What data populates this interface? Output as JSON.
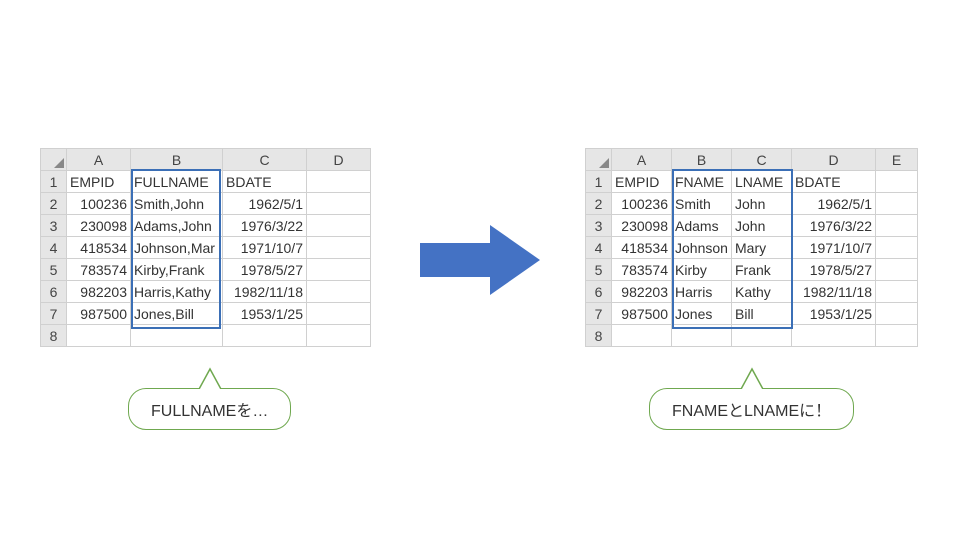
{
  "left": {
    "cols": [
      "A",
      "B",
      "C",
      "D"
    ],
    "rows": [
      "1",
      "2",
      "3",
      "4",
      "5",
      "6",
      "7",
      "8"
    ],
    "header": {
      "A": "EMPID",
      "B": "FULLNAME",
      "C": "BDATE"
    },
    "data": [
      {
        "A": "100236",
        "B": "Smith,John",
        "C": "1962/5/1"
      },
      {
        "A": "230098",
        "B": "Adams,John",
        "C": "1976/3/22"
      },
      {
        "A": "418534",
        "B": "Johnson,Mar",
        "C": "1971/10/7"
      },
      {
        "A": "783574",
        "B": "Kirby,Frank",
        "C": "1978/5/27"
      },
      {
        "A": "982203",
        "B": "Harris,Kathy",
        "C": "1982/11/18"
      },
      {
        "A": "987500",
        "B": "Jones,Bill",
        "C": "1953/1/25"
      }
    ],
    "callout": "FULLNAMEを…"
  },
  "right": {
    "cols": [
      "A",
      "B",
      "C",
      "D",
      "E"
    ],
    "rows": [
      "1",
      "2",
      "3",
      "4",
      "5",
      "6",
      "7",
      "8"
    ],
    "header": {
      "A": "EMPID",
      "B": "FNAME",
      "C": "LNAME",
      "D": "BDATE"
    },
    "data": [
      {
        "A": "100236",
        "B": "Smith",
        "C": "John",
        "D": "1962/5/1"
      },
      {
        "A": "230098",
        "B": "Adams",
        "C": "John",
        "D": "1976/3/22"
      },
      {
        "A": "418534",
        "B": "Johnson",
        "C": "Mary",
        "D": "1971/10/7"
      },
      {
        "A": "783574",
        "B": "Kirby",
        "C": "Frank",
        "D": "1978/5/27"
      },
      {
        "A": "982203",
        "B": "Harris",
        "C": "Kathy",
        "D": "1982/11/18"
      },
      {
        "A": "987500",
        "B": "Jones",
        "C": "Bill",
        "D": "1953/1/25"
      }
    ],
    "callout": "FNAMEとLNAMEに！"
  },
  "colors": {
    "arrow": "#4472c4",
    "hl": "#3b6fb6",
    "callout": "#6fa84f"
  }
}
